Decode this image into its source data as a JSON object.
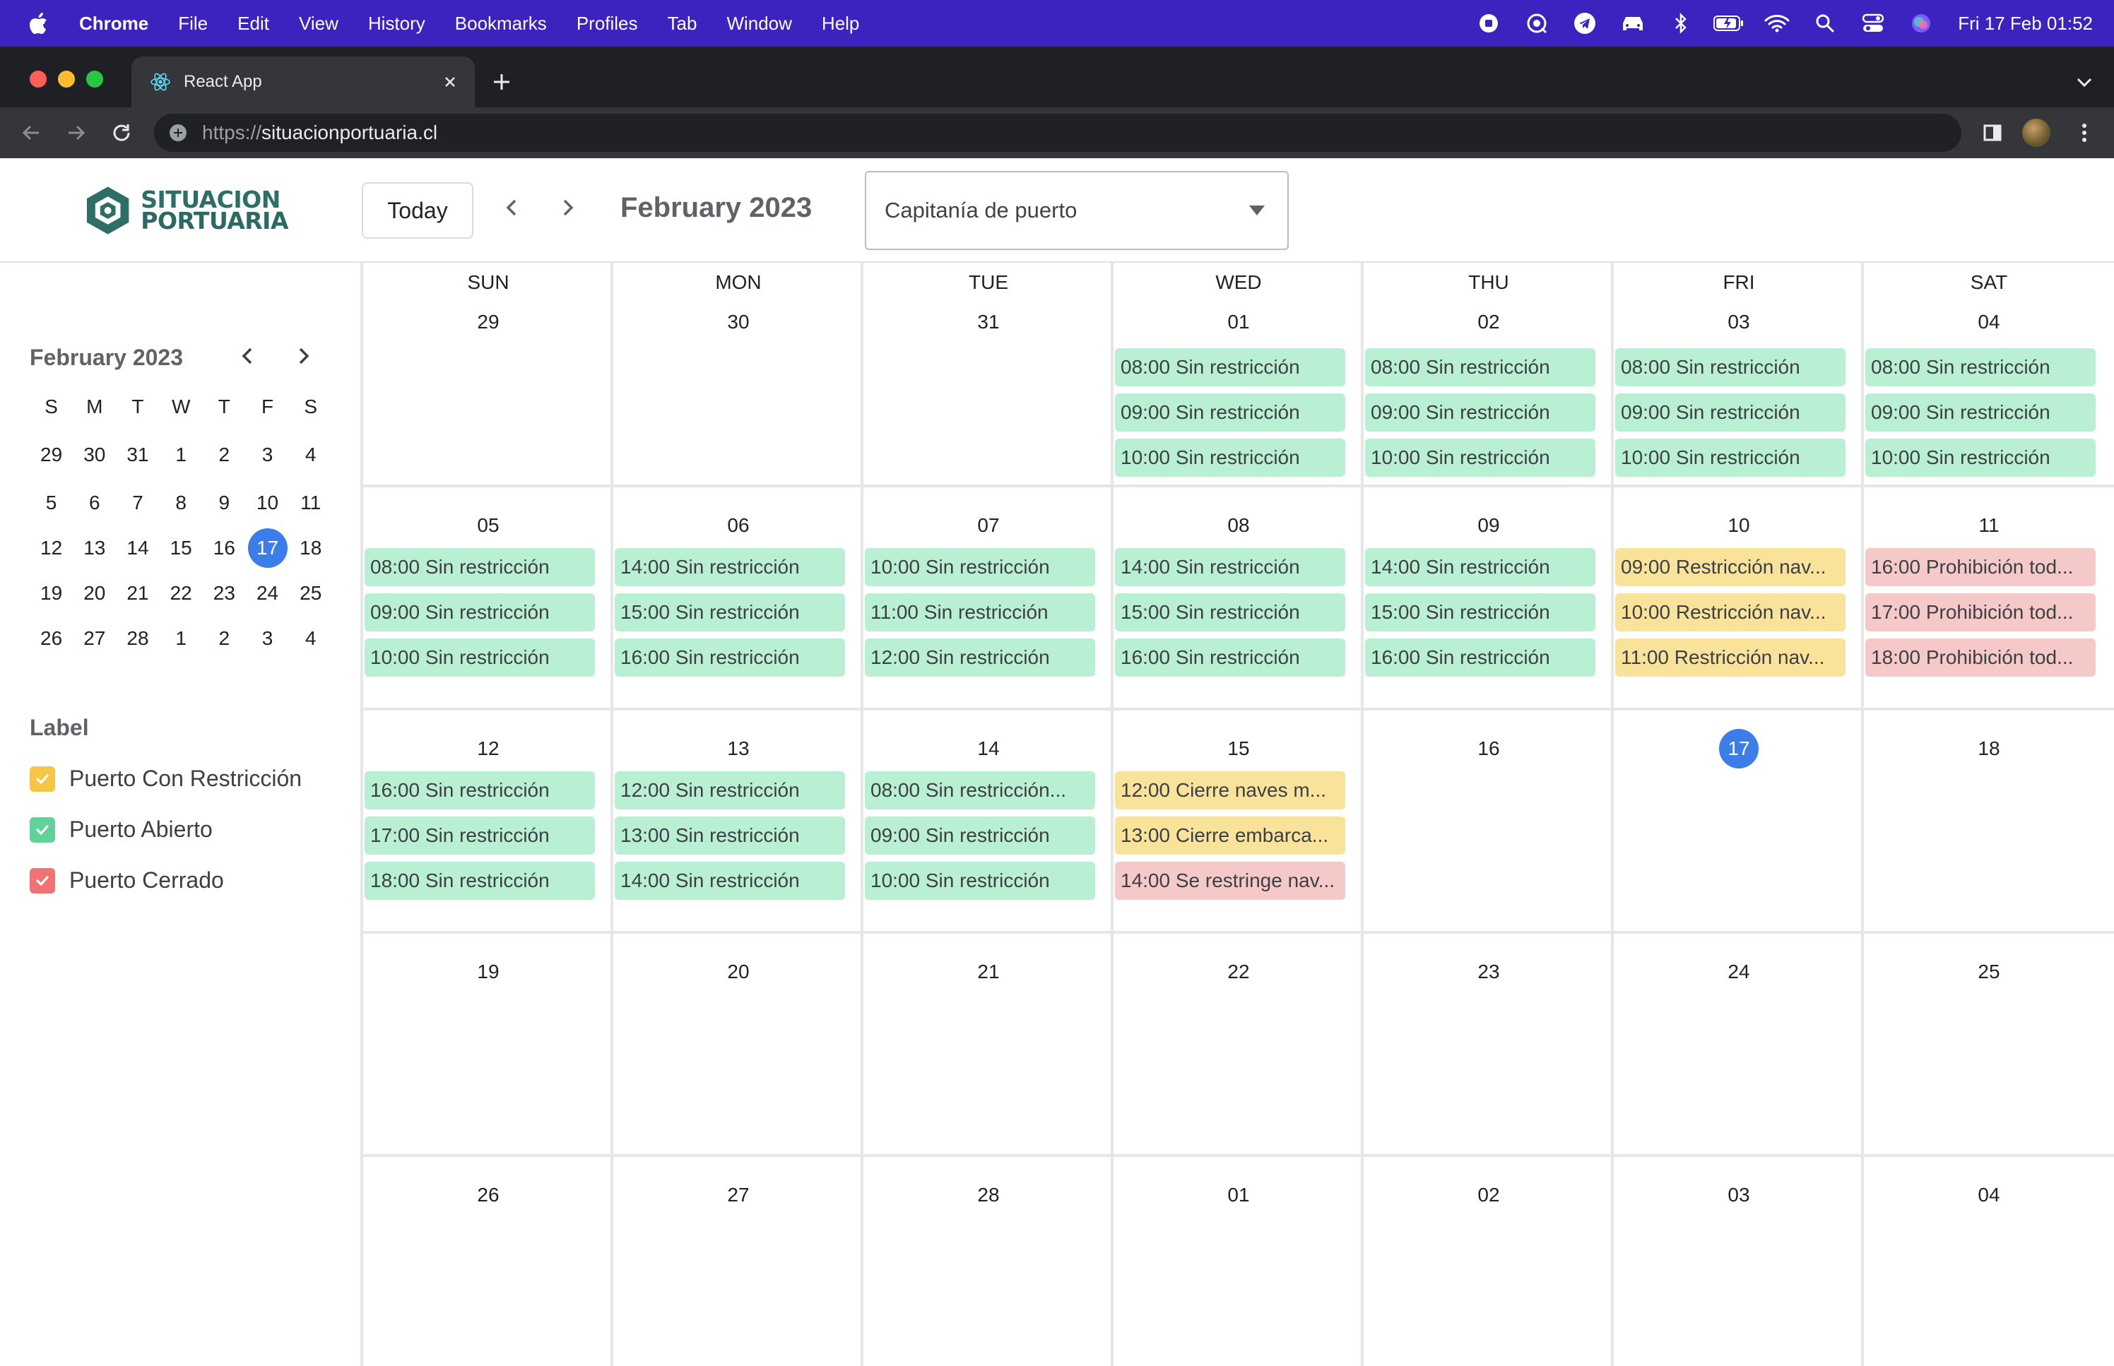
{
  "menubar": {
    "items": [
      "Chrome",
      "File",
      "Edit",
      "View",
      "History",
      "Bookmarks",
      "Profiles",
      "Tab",
      "Window",
      "Help"
    ],
    "clock": "Fri 17 Feb  01:52"
  },
  "browser": {
    "tab_title": "React App",
    "url_scheme": "https://",
    "url_host": "situacionportuaria.cl"
  },
  "app": {
    "logo_line1": "SITUACION",
    "logo_line2": "PORTUARIA",
    "today_label": "Today",
    "month_title": "February 2023",
    "capitania_select": "Capitanía de puerto"
  },
  "colors": {
    "accent": "#3b7de9",
    "menubar": "#3c22bf",
    "open": "#b9f0d4",
    "restricted": "#f9e39a",
    "closed": "#f6c9c9",
    "label_restricted": "#f6c543",
    "label_open": "#5fd39a",
    "label_closed": "#f07272"
  },
  "mini_calendar": {
    "title": "February 2023",
    "weekdays": [
      "S",
      "M",
      "T",
      "W",
      "T",
      "F",
      "S"
    ],
    "weeks": [
      [
        "29",
        "30",
        "31",
        "1",
        "2",
        "3",
        "4"
      ],
      [
        "5",
        "6",
        "7",
        "8",
        "9",
        "10",
        "11"
      ],
      [
        "12",
        "13",
        "14",
        "15",
        "16",
        "17",
        "18"
      ],
      [
        "19",
        "20",
        "21",
        "22",
        "23",
        "24",
        "25"
      ],
      [
        "26",
        "27",
        "28",
        "1",
        "2",
        "3",
        "4"
      ]
    ],
    "selected": "17"
  },
  "labels": {
    "title": "Label",
    "items": [
      {
        "text": "Puerto Con Restricción",
        "color": "#f6c543",
        "checked": true
      },
      {
        "text": "Puerto Abierto",
        "color": "#5fd39a",
        "checked": true
      },
      {
        "text": "Puerto Cerrado",
        "color": "#f07272",
        "checked": true
      }
    ]
  },
  "calendar": {
    "weekdays": [
      "SUN",
      "MON",
      "TUE",
      "WED",
      "THU",
      "FRI",
      "SAT"
    ],
    "today": "17",
    "weeks": [
      [
        {
          "day": "29",
          "events": []
        },
        {
          "day": "30",
          "events": []
        },
        {
          "day": "31",
          "events": []
        },
        {
          "day": "01",
          "events": [
            {
              "text": "08:00 Sin restricción",
              "status": "green"
            },
            {
              "text": "09:00 Sin restricción",
              "status": "green"
            },
            {
              "text": "10:00 Sin restricción",
              "status": "green"
            }
          ]
        },
        {
          "day": "02",
          "events": [
            {
              "text": "08:00 Sin restricción",
              "status": "green"
            },
            {
              "text": "09:00 Sin restricción",
              "status": "green"
            },
            {
              "text": "10:00 Sin restricción",
              "status": "green"
            }
          ]
        },
        {
          "day": "03",
          "events": [
            {
              "text": "08:00 Sin restricción",
              "status": "green"
            },
            {
              "text": "09:00 Sin restricción",
              "status": "green"
            },
            {
              "text": "10:00 Sin restricción",
              "status": "green"
            }
          ]
        },
        {
          "day": "04",
          "events": [
            {
              "text": "08:00 Sin restricción",
              "status": "green"
            },
            {
              "text": "09:00 Sin restricción",
              "status": "green"
            },
            {
              "text": "10:00 Sin restricción",
              "status": "green"
            }
          ]
        }
      ],
      [
        {
          "day": "05",
          "events": [
            {
              "text": "08:00 Sin restricción",
              "status": "green"
            },
            {
              "text": "09:00 Sin restricción",
              "status": "green"
            },
            {
              "text": "10:00 Sin restricción",
              "status": "green"
            }
          ]
        },
        {
          "day": "06",
          "events": [
            {
              "text": "14:00 Sin restricción",
              "status": "green"
            },
            {
              "text": "15:00 Sin restricción",
              "status": "green"
            },
            {
              "text": "16:00 Sin restricción",
              "status": "green"
            }
          ]
        },
        {
          "day": "07",
          "events": [
            {
              "text": "10:00 Sin restricción",
              "status": "green"
            },
            {
              "text": "11:00 Sin restricción",
              "status": "green"
            },
            {
              "text": "12:00 Sin restricción",
              "status": "green"
            }
          ]
        },
        {
          "day": "08",
          "events": [
            {
              "text": "14:00 Sin restricción",
              "status": "green"
            },
            {
              "text": "15:00 Sin restricción",
              "status": "green"
            },
            {
              "text": "16:00 Sin restricción",
              "status": "green"
            }
          ]
        },
        {
          "day": "09",
          "events": [
            {
              "text": "14:00 Sin restricción",
              "status": "green"
            },
            {
              "text": "15:00 Sin restricción",
              "status": "green"
            },
            {
              "text": "16:00 Sin restricción",
              "status": "green"
            }
          ]
        },
        {
          "day": "10",
          "events": [
            {
              "text": "09:00 Restricción nav...",
              "status": "yellow"
            },
            {
              "text": "10:00 Restricción nav...",
              "status": "yellow"
            },
            {
              "text": "11:00 Restricción nav...",
              "status": "yellow"
            }
          ]
        },
        {
          "day": "11",
          "events": [
            {
              "text": "16:00 Prohibición tod...",
              "status": "red"
            },
            {
              "text": "17:00 Prohibición tod...",
              "status": "red"
            },
            {
              "text": "18:00 Prohibición tod...",
              "status": "red"
            }
          ]
        }
      ],
      [
        {
          "day": "12",
          "events": [
            {
              "text": "16:00 Sin restricción",
              "status": "green"
            },
            {
              "text": "17:00 Sin restricción",
              "status": "green"
            },
            {
              "text": "18:00 Sin restricción",
              "status": "green"
            }
          ]
        },
        {
          "day": "13",
          "events": [
            {
              "text": "12:00 Sin restricción",
              "status": "green"
            },
            {
              "text": "13:00 Sin restricción",
              "status": "green"
            },
            {
              "text": "14:00 Sin restricción",
              "status": "green"
            }
          ]
        },
        {
          "day": "14",
          "events": [
            {
              "text": "08:00 Sin restricción...",
              "status": "green"
            },
            {
              "text": "09:00 Sin restricción",
              "status": "green"
            },
            {
              "text": "10:00 Sin restricción",
              "status": "green"
            }
          ]
        },
        {
          "day": "15",
          "events": [
            {
              "text": "12:00 Cierre naves m...",
              "status": "yellow"
            },
            {
              "text": "13:00 Cierre embarca...",
              "status": "yellow"
            },
            {
              "text": "14:00 Se restringe nav...",
              "status": "red"
            }
          ]
        },
        {
          "day": "16",
          "events": []
        },
        {
          "day": "17",
          "events": []
        },
        {
          "day": "18",
          "events": []
        }
      ],
      [
        {
          "day": "19",
          "events": []
        },
        {
          "day": "20",
          "events": []
        },
        {
          "day": "21",
          "events": []
        },
        {
          "day": "22",
          "events": []
        },
        {
          "day": "23",
          "events": []
        },
        {
          "day": "24",
          "events": []
        },
        {
          "day": "25",
          "events": []
        }
      ],
      [
        {
          "day": "26",
          "events": []
        },
        {
          "day": "27",
          "events": []
        },
        {
          "day": "28",
          "events": []
        },
        {
          "day": "01",
          "events": []
        },
        {
          "day": "02",
          "events": []
        },
        {
          "day": "03",
          "events": []
        },
        {
          "day": "04",
          "events": []
        }
      ]
    ]
  }
}
